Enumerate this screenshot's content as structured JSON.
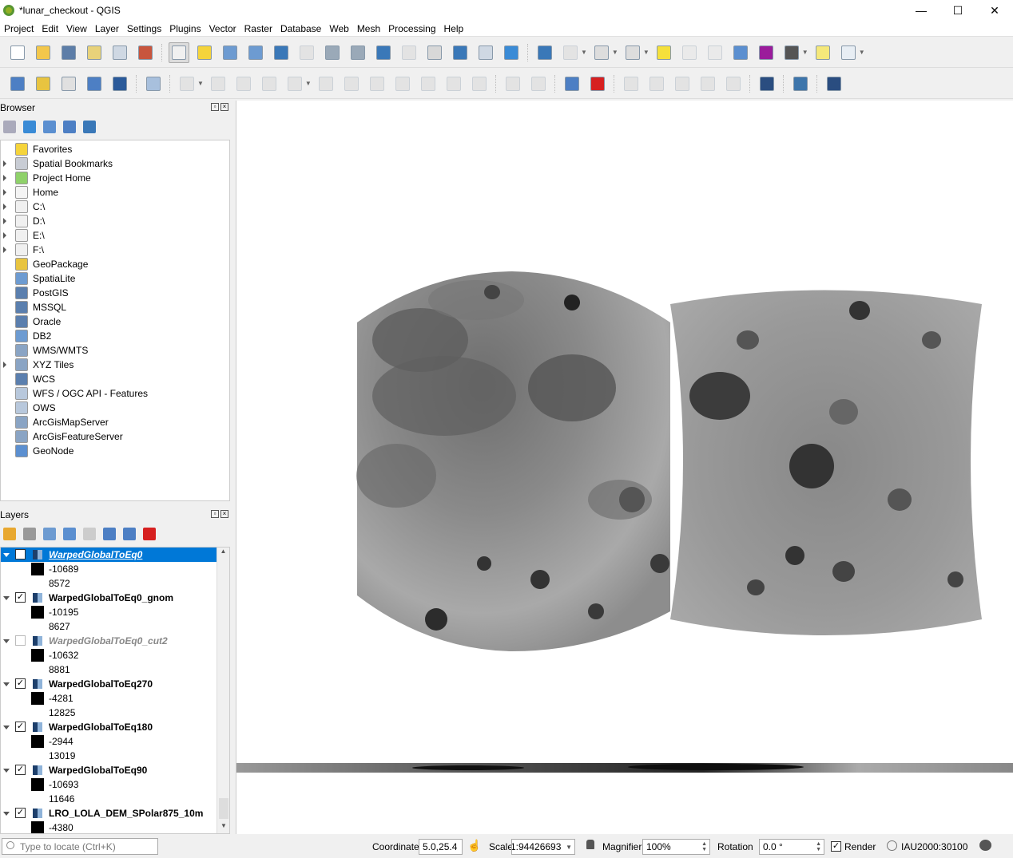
{
  "window": {
    "title": "*lunar_checkout - QGIS",
    "minimize": "—",
    "maximize": "☐",
    "close": "✕"
  },
  "menu": [
    "Project",
    "Edit",
    "View",
    "Layer",
    "Settings",
    "Plugins",
    "Vector",
    "Raster",
    "Database",
    "Web",
    "Mesh",
    "Processing",
    "Help"
  ],
  "toolbar1": [
    {
      "name": "new-project-icon",
      "color": "#ffffff"
    },
    {
      "name": "open-project-icon",
      "color": "#f3c74b"
    },
    {
      "name": "save-project-icon",
      "color": "#5d7ea8"
    },
    {
      "name": "new-print-layout-icon",
      "color": "#e8d27a"
    },
    {
      "name": "layout-manager-icon",
      "color": "#cfd8e3"
    },
    {
      "name": "style-manager-icon",
      "color": "#c8553d"
    },
    {
      "sep": true
    },
    {
      "name": "pan-map-icon",
      "color": "#f0f0f0",
      "active": true
    },
    {
      "name": "pan-to-selection-icon",
      "color": "#f5d43b"
    },
    {
      "name": "zoom-in-icon",
      "color": "#6d9bd1"
    },
    {
      "name": "zoom-out-icon",
      "color": "#6d9bd1"
    },
    {
      "name": "zoom-full-icon",
      "color": "#3a78b8"
    },
    {
      "name": "zoom-to-selection-icon",
      "color": "#cccccc",
      "disabled": true
    },
    {
      "name": "zoom-to-layer-icon",
      "color": "#9aa9b8"
    },
    {
      "name": "zoom-native-icon",
      "color": "#9aa9b8"
    },
    {
      "name": "zoom-last-icon",
      "color": "#3a78b8"
    },
    {
      "name": "zoom-next-icon",
      "color": "#cccccc",
      "disabled": true
    },
    {
      "name": "new-map-view-icon",
      "color": "#d8d8d8"
    },
    {
      "name": "new-bookmark-icon",
      "color": "#3a78b8"
    },
    {
      "name": "show-bookmarks-icon",
      "color": "#cfd8e3"
    },
    {
      "name": "refresh-icon",
      "color": "#3a8bd6"
    },
    {
      "sep": true
    },
    {
      "name": "identify-icon",
      "color": "#3a78b8"
    },
    {
      "name": "run-action-icon",
      "color": "#cccccc",
      "disabled": true,
      "dropdown": true
    },
    {
      "name": "select-features-icon",
      "color": "#dddddd",
      "dropdown": true
    },
    {
      "name": "open-attribute-table-icon",
      "color": "#dddddd",
      "dropdown": true
    },
    {
      "name": "deselect-all-icon",
      "color": "#f5e03b"
    },
    {
      "name": "field-calculator-icon",
      "color": "#e0e0e0",
      "disabled": true
    },
    {
      "name": "statistics-panel-icon",
      "color": "#e0e0e0",
      "disabled": true
    },
    {
      "name": "toolbox-icon",
      "color": "#5b8fd0"
    },
    {
      "name": "sum-icon",
      "color": "#9b1c9b"
    },
    {
      "name": "measure-icon",
      "color": "#555555",
      "dropdown": true
    },
    {
      "name": "map-tips-icon",
      "color": "#f5e87a"
    },
    {
      "name": "text-annotation-icon",
      "color": "#e8eef4",
      "dropdown": true
    }
  ],
  "toolbar2": [
    {
      "name": "data-source-manager-icon",
      "color": "#4d7fc4"
    },
    {
      "name": "new-geopackage-layer-icon",
      "color": "#e8c440"
    },
    {
      "name": "new-shapefile-layer-icon",
      "color": "#e0e0e0"
    },
    {
      "name": "new-spatialite-layer-icon",
      "color": "#4d7fc4"
    },
    {
      "name": "new-temporary-layer-icon",
      "color": "#2a5a9a"
    },
    {
      "sep": true
    },
    {
      "name": "new-virtual-layer-icon",
      "color": "#a8c0dd"
    },
    {
      "sep": true
    },
    {
      "name": "current-edits-icon",
      "color": "#cccccc",
      "disabled": true,
      "dropdown": true
    },
    {
      "name": "toggle-editing-icon",
      "color": "#cccccc",
      "disabled": true
    },
    {
      "name": "save-edits-icon",
      "color": "#cccccc",
      "disabled": true
    },
    {
      "name": "add-point-icon",
      "color": "#cccccc",
      "disabled": true
    },
    {
      "name": "vertex-tool-icon",
      "color": "#cccccc",
      "disabled": true,
      "dropdown": true
    },
    {
      "name": "modify-attributes-icon",
      "color": "#cccccc",
      "disabled": true
    },
    {
      "name": "delete-selected-icon",
      "color": "#cccccc",
      "disabled": true
    },
    {
      "name": "cut-features-icon",
      "color": "#cccccc",
      "disabled": true
    },
    {
      "name": "copy-features-icon",
      "color": "#cccccc",
      "disabled": true
    },
    {
      "name": "paste-features-icon",
      "color": "#cccccc",
      "disabled": true
    },
    {
      "name": "undo-icon",
      "color": "#cccccc",
      "disabled": true
    },
    {
      "name": "redo-icon",
      "color": "#cccccc",
      "disabled": true
    },
    {
      "sep": true
    },
    {
      "name": "label-toolbar-icon",
      "color": "#cccccc",
      "disabled": true
    },
    {
      "name": "diagram-toolbar-icon",
      "color": "#cccccc",
      "disabled": true
    },
    {
      "sep": true
    },
    {
      "name": "pin-labels-icon",
      "color": "#4d7fc4"
    },
    {
      "name": "highlight-pinned-labels-icon",
      "color": "#d62020"
    },
    {
      "sep": true
    },
    {
      "name": "move-label-icon",
      "color": "#cccccc",
      "disabled": true
    },
    {
      "name": "show-hide-labels-icon",
      "color": "#cccccc",
      "disabled": true
    },
    {
      "name": "move-label-arrow-icon",
      "color": "#cccccc",
      "disabled": true
    },
    {
      "name": "rotate-label-icon",
      "color": "#cccccc",
      "disabled": true
    },
    {
      "name": "change-label-icon",
      "color": "#cccccc",
      "disabled": true
    },
    {
      "sep": true
    },
    {
      "name": "metasearch-icon",
      "color": "#2a4d80"
    },
    {
      "sep": true
    },
    {
      "name": "python-console-icon",
      "color": "#3d75ab"
    },
    {
      "sep": true
    },
    {
      "name": "help-icon",
      "color": "#2a4d80"
    }
  ],
  "browser": {
    "title": "Browser",
    "tools": [
      {
        "name": "add-selected-layers-icon",
        "color": "#aab"
      },
      {
        "name": "refresh-icon",
        "color": "#3a8bd6"
      },
      {
        "name": "filter-icon",
        "color": "#5b8fd0"
      },
      {
        "name": "collapse-all-icon",
        "color": "#4d7fc4"
      },
      {
        "name": "properties-info-icon",
        "color": "#3a78b8"
      }
    ],
    "items": [
      {
        "label": "Favorites",
        "icon": "star-icon",
        "color": "#f5d43b",
        "expand": false
      },
      {
        "label": "Spatial Bookmarks",
        "icon": "bookmark-icon",
        "color": "#c8ccd4",
        "expand": true
      },
      {
        "label": "Project Home",
        "icon": "project-home-icon",
        "color": "#8fd16a",
        "expand": true
      },
      {
        "label": "Home",
        "icon": "home-folder-icon",
        "color": "#f4f4f4",
        "expand": true
      },
      {
        "label": "C:\\",
        "icon": "folder-icon",
        "color": "#f0f0f0",
        "expand": true
      },
      {
        "label": "D:\\",
        "icon": "folder-icon",
        "color": "#f0f0f0",
        "expand": true
      },
      {
        "label": "E:\\",
        "icon": "folder-icon",
        "color": "#f0f0f0",
        "expand": true
      },
      {
        "label": "F:\\",
        "icon": "folder-icon",
        "color": "#f0f0f0",
        "expand": true
      },
      {
        "label": "GeoPackage",
        "icon": "geopackage-icon",
        "color": "#e8c440",
        "expand": false
      },
      {
        "label": "SpatiaLite",
        "icon": "spatialite-icon",
        "color": "#6d9bd1",
        "expand": false
      },
      {
        "label": "PostGIS",
        "icon": "postgis-icon",
        "color": "#5b7fae",
        "expand": false
      },
      {
        "label": "MSSQL",
        "icon": "mssql-icon",
        "color": "#5b7fae",
        "expand": false
      },
      {
        "label": "Oracle",
        "icon": "oracle-icon",
        "color": "#5b7fae",
        "expand": false
      },
      {
        "label": "DB2",
        "icon": "db2-icon",
        "color": "#6d9bd1",
        "expand": false
      },
      {
        "label": "WMS/WMTS",
        "icon": "wms-globe-icon",
        "color": "#8aa4c4",
        "expand": false
      },
      {
        "label": "XYZ Tiles",
        "icon": "xyz-globe-icon",
        "color": "#8aa4c4",
        "expand": true
      },
      {
        "label": "WCS",
        "icon": "wcs-globe-icon",
        "color": "#5b7fae",
        "expand": false
      },
      {
        "label": "WFS / OGC API - Features",
        "icon": "wfs-globe-icon",
        "color": "#b8c8dc",
        "expand": false
      },
      {
        "label": "OWS",
        "icon": "ows-globe-icon",
        "color": "#b8c8dc",
        "expand": false
      },
      {
        "label": "ArcGisMapServer",
        "icon": "arcgis-map-icon",
        "color": "#8aa4c4",
        "expand": false
      },
      {
        "label": "ArcGisFeatureServer",
        "icon": "arcgis-feature-icon",
        "color": "#8aa4c4",
        "expand": false
      },
      {
        "label": "GeoNode",
        "icon": "geonode-icon",
        "color": "#5b8fd0",
        "expand": false
      }
    ]
  },
  "layers": {
    "title": "Layers",
    "tools": [
      {
        "name": "open-layer-styling-icon",
        "color": "#e8a830"
      },
      {
        "name": "add-group-icon",
        "color": "#999"
      },
      {
        "name": "manage-map-themes-icon",
        "color": "#6d9bd1"
      },
      {
        "name": "filter-legend-icon",
        "color": "#5b8fd0"
      },
      {
        "name": "filter-by-expression-icon",
        "color": "#ccc"
      },
      {
        "name": "expand-all-icon",
        "color": "#4d7fc4"
      },
      {
        "name": "collapse-all-icon",
        "color": "#4d7fc4"
      },
      {
        "name": "remove-layer-icon",
        "color": "#d62020"
      }
    ],
    "items": [
      {
        "name": "WarpedGlobalToEq0",
        "checked": false,
        "selected": true,
        "style": "selected",
        "min": "-10689",
        "max": "8572"
      },
      {
        "name": "WarpedGlobalToEq0_gnom",
        "checked": true,
        "selected": false,
        "style": "bold",
        "min": "-10195",
        "max": "8627"
      },
      {
        "name": "WarpedGlobalToEq0_cut2",
        "checked": false,
        "selected": false,
        "style": "italic",
        "min": "-10632",
        "max": "8881"
      },
      {
        "name": "WarpedGlobalToEq270",
        "checked": true,
        "selected": false,
        "style": "bold",
        "min": "-4281",
        "max": "12825"
      },
      {
        "name": "WarpedGlobalToEq180",
        "checked": true,
        "selected": false,
        "style": "bold",
        "min": "-2944",
        "max": "13019"
      },
      {
        "name": "WarpedGlobalToEq90",
        "checked": true,
        "selected": false,
        "style": "bold",
        "min": "-10693",
        "max": "11646"
      },
      {
        "name": "LRO_LOLA_DEM_SPolar875_10m",
        "checked": true,
        "selected": false,
        "style": "bold",
        "min": "-4380",
        "max": ""
      }
    ]
  },
  "status": {
    "locate_placeholder": "Type to locate (Ctrl+K)",
    "coordinate_label": "Coordinate",
    "coordinate_value": "5.0,25.4",
    "scale_label": "Scale",
    "scale_value": "1:94426693",
    "magnifier_label": "Magnifier",
    "magnifier_value": "100%",
    "rotation_label": "Rotation",
    "rotation_value": "0.0 °",
    "render_label": "Render",
    "render_checked": true,
    "crs": "IAU2000:30100"
  }
}
